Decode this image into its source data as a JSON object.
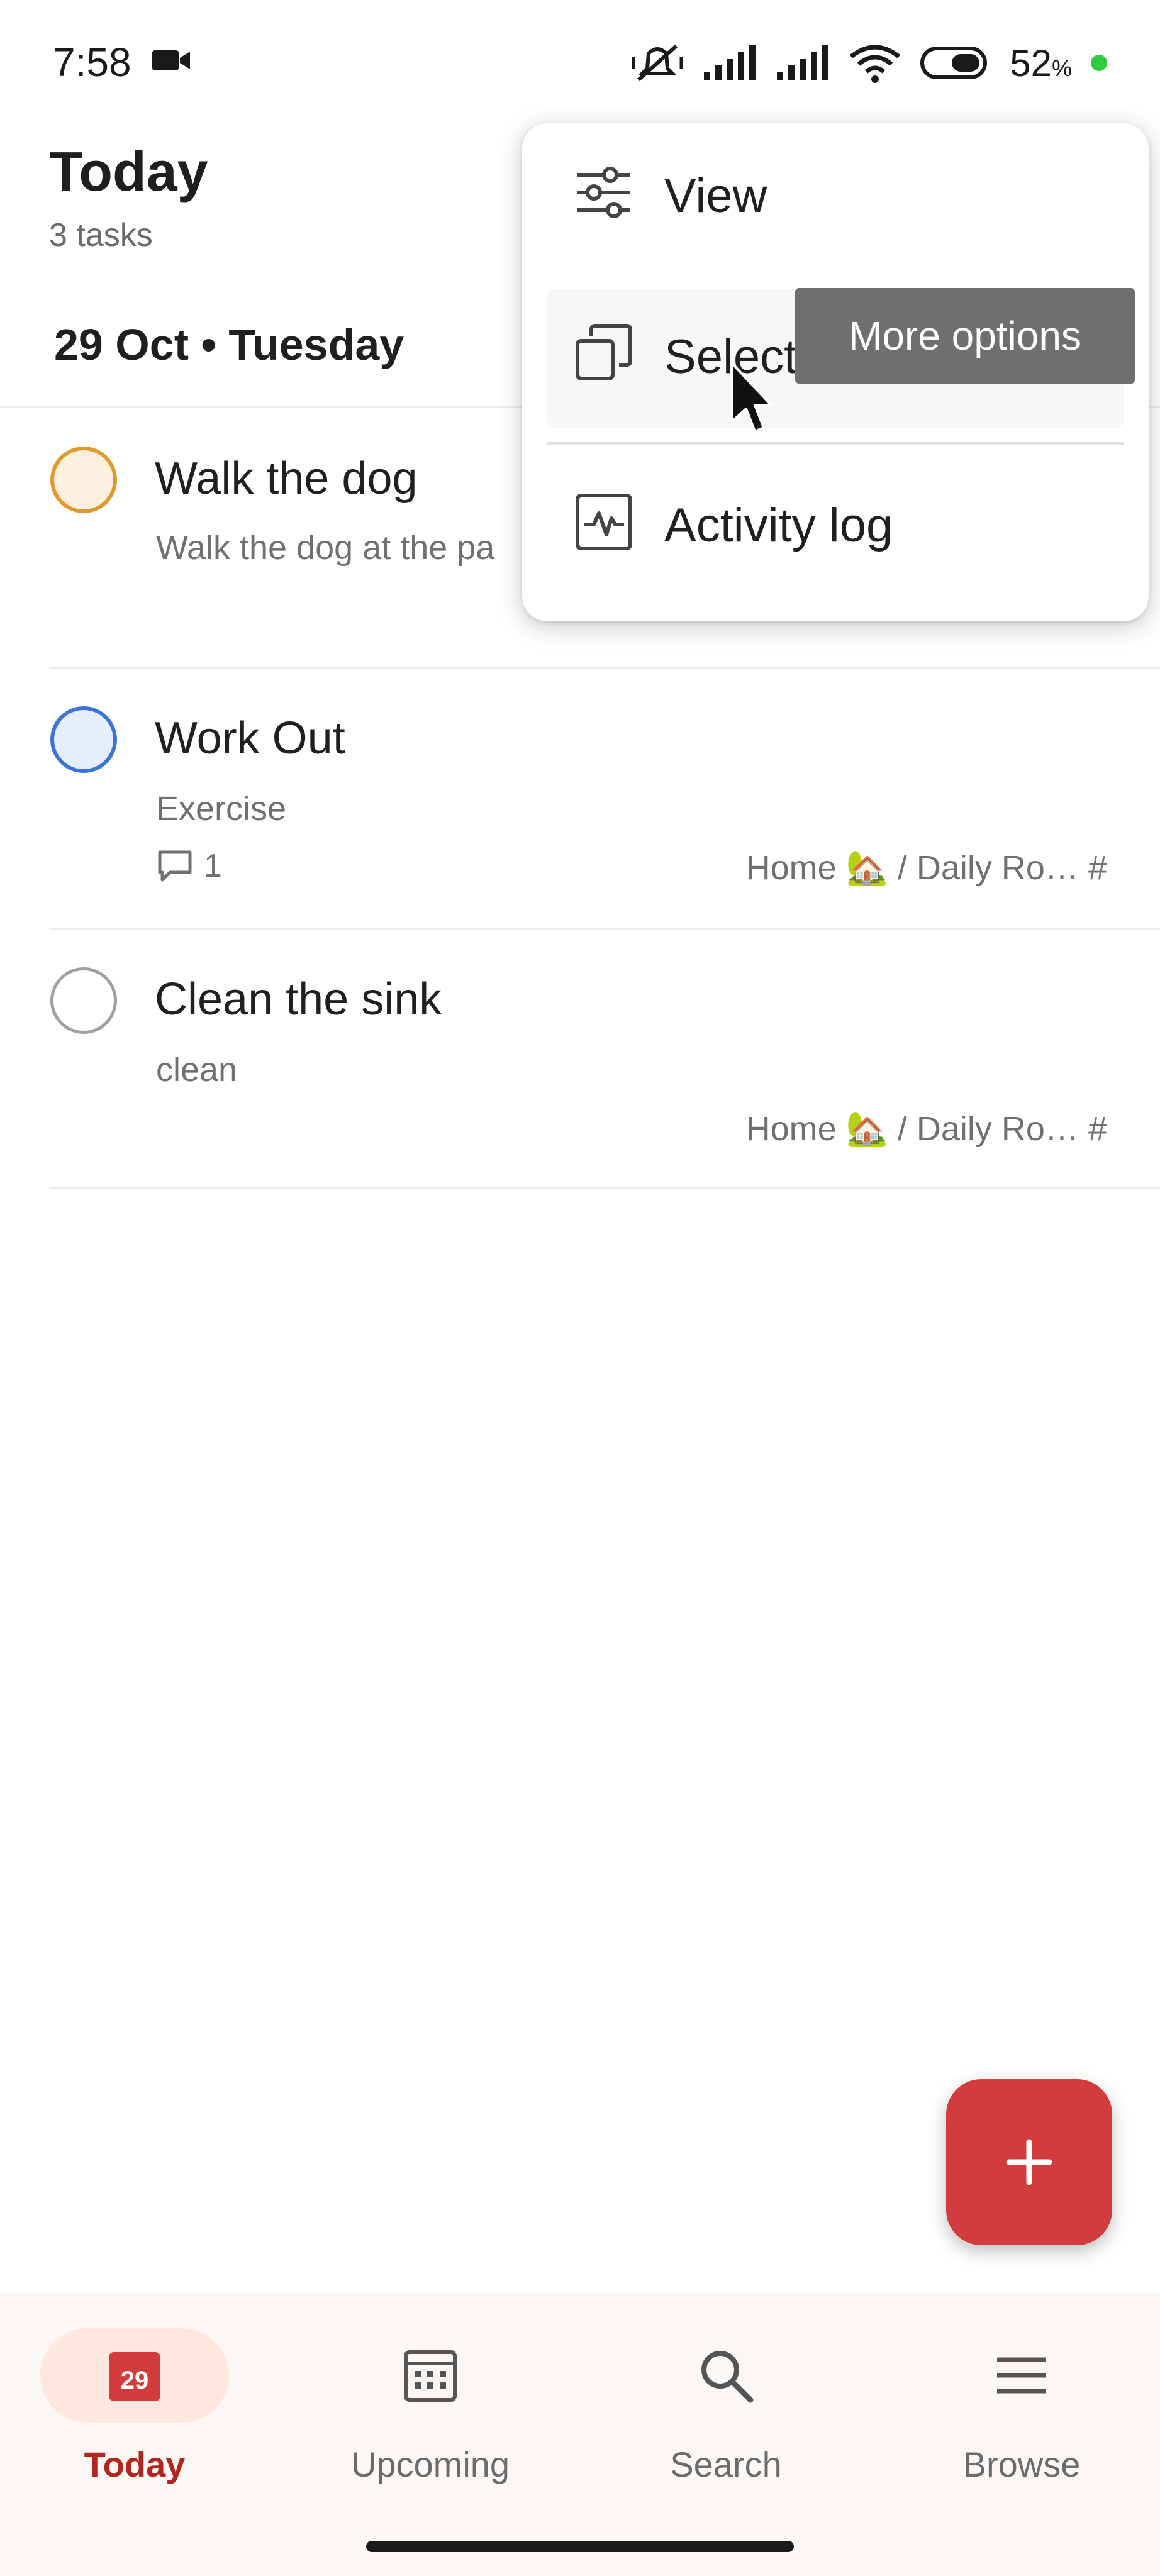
{
  "status_bar": {
    "time": "7:58",
    "battery_value": "52",
    "battery_pct_sign": "%",
    "icons": [
      "video-camera-icon",
      "mute-vibrate-icon",
      "signal-icon",
      "signal-icon",
      "wifi-icon",
      "battery-icon",
      "charging-dot-icon"
    ]
  },
  "header": {
    "title": "Today",
    "subtitle": "3 tasks",
    "date_heading": "29 Oct • Tuesday"
  },
  "tasks": [
    {
      "name": "Walk the dog",
      "description": "Walk the dog at the pa",
      "priority_color": "#e09a2b"
    },
    {
      "name": "Work Out",
      "description": "Exercise",
      "comments": "1",
      "project": "Home 🏡 / Daily Ro… #",
      "priority_color": "#3b74d6"
    },
    {
      "name": "Clean the sink",
      "description": "clean",
      "project": "Home 🏡 / Daily Ro… #",
      "priority_color": "#a0a0a0"
    }
  ],
  "menu": {
    "items": [
      {
        "label": "View",
        "icon": "sliders-icon"
      },
      {
        "label": "Select",
        "icon": "copy-select-icon"
      },
      {
        "label": "Activity log",
        "icon": "activity-log-icon"
      }
    ]
  },
  "tooltip": {
    "text": "More options"
  },
  "fab": {
    "icon": "plus-icon",
    "color": "#d23c3c"
  },
  "bottom_nav": {
    "items": [
      {
        "label": "Today",
        "icon": "calendar-today-icon",
        "badge": "29",
        "active": true
      },
      {
        "label": "Upcoming",
        "icon": "calendar-grid-icon",
        "active": false
      },
      {
        "label": "Search",
        "icon": "search-icon",
        "active": false
      },
      {
        "label": "Browse",
        "icon": "menu-icon",
        "active": false
      }
    ]
  },
  "colors": {
    "accent": "#d23c3c",
    "active_nav_text": "#b3261e",
    "active_nav_bg": "#fde7df"
  }
}
